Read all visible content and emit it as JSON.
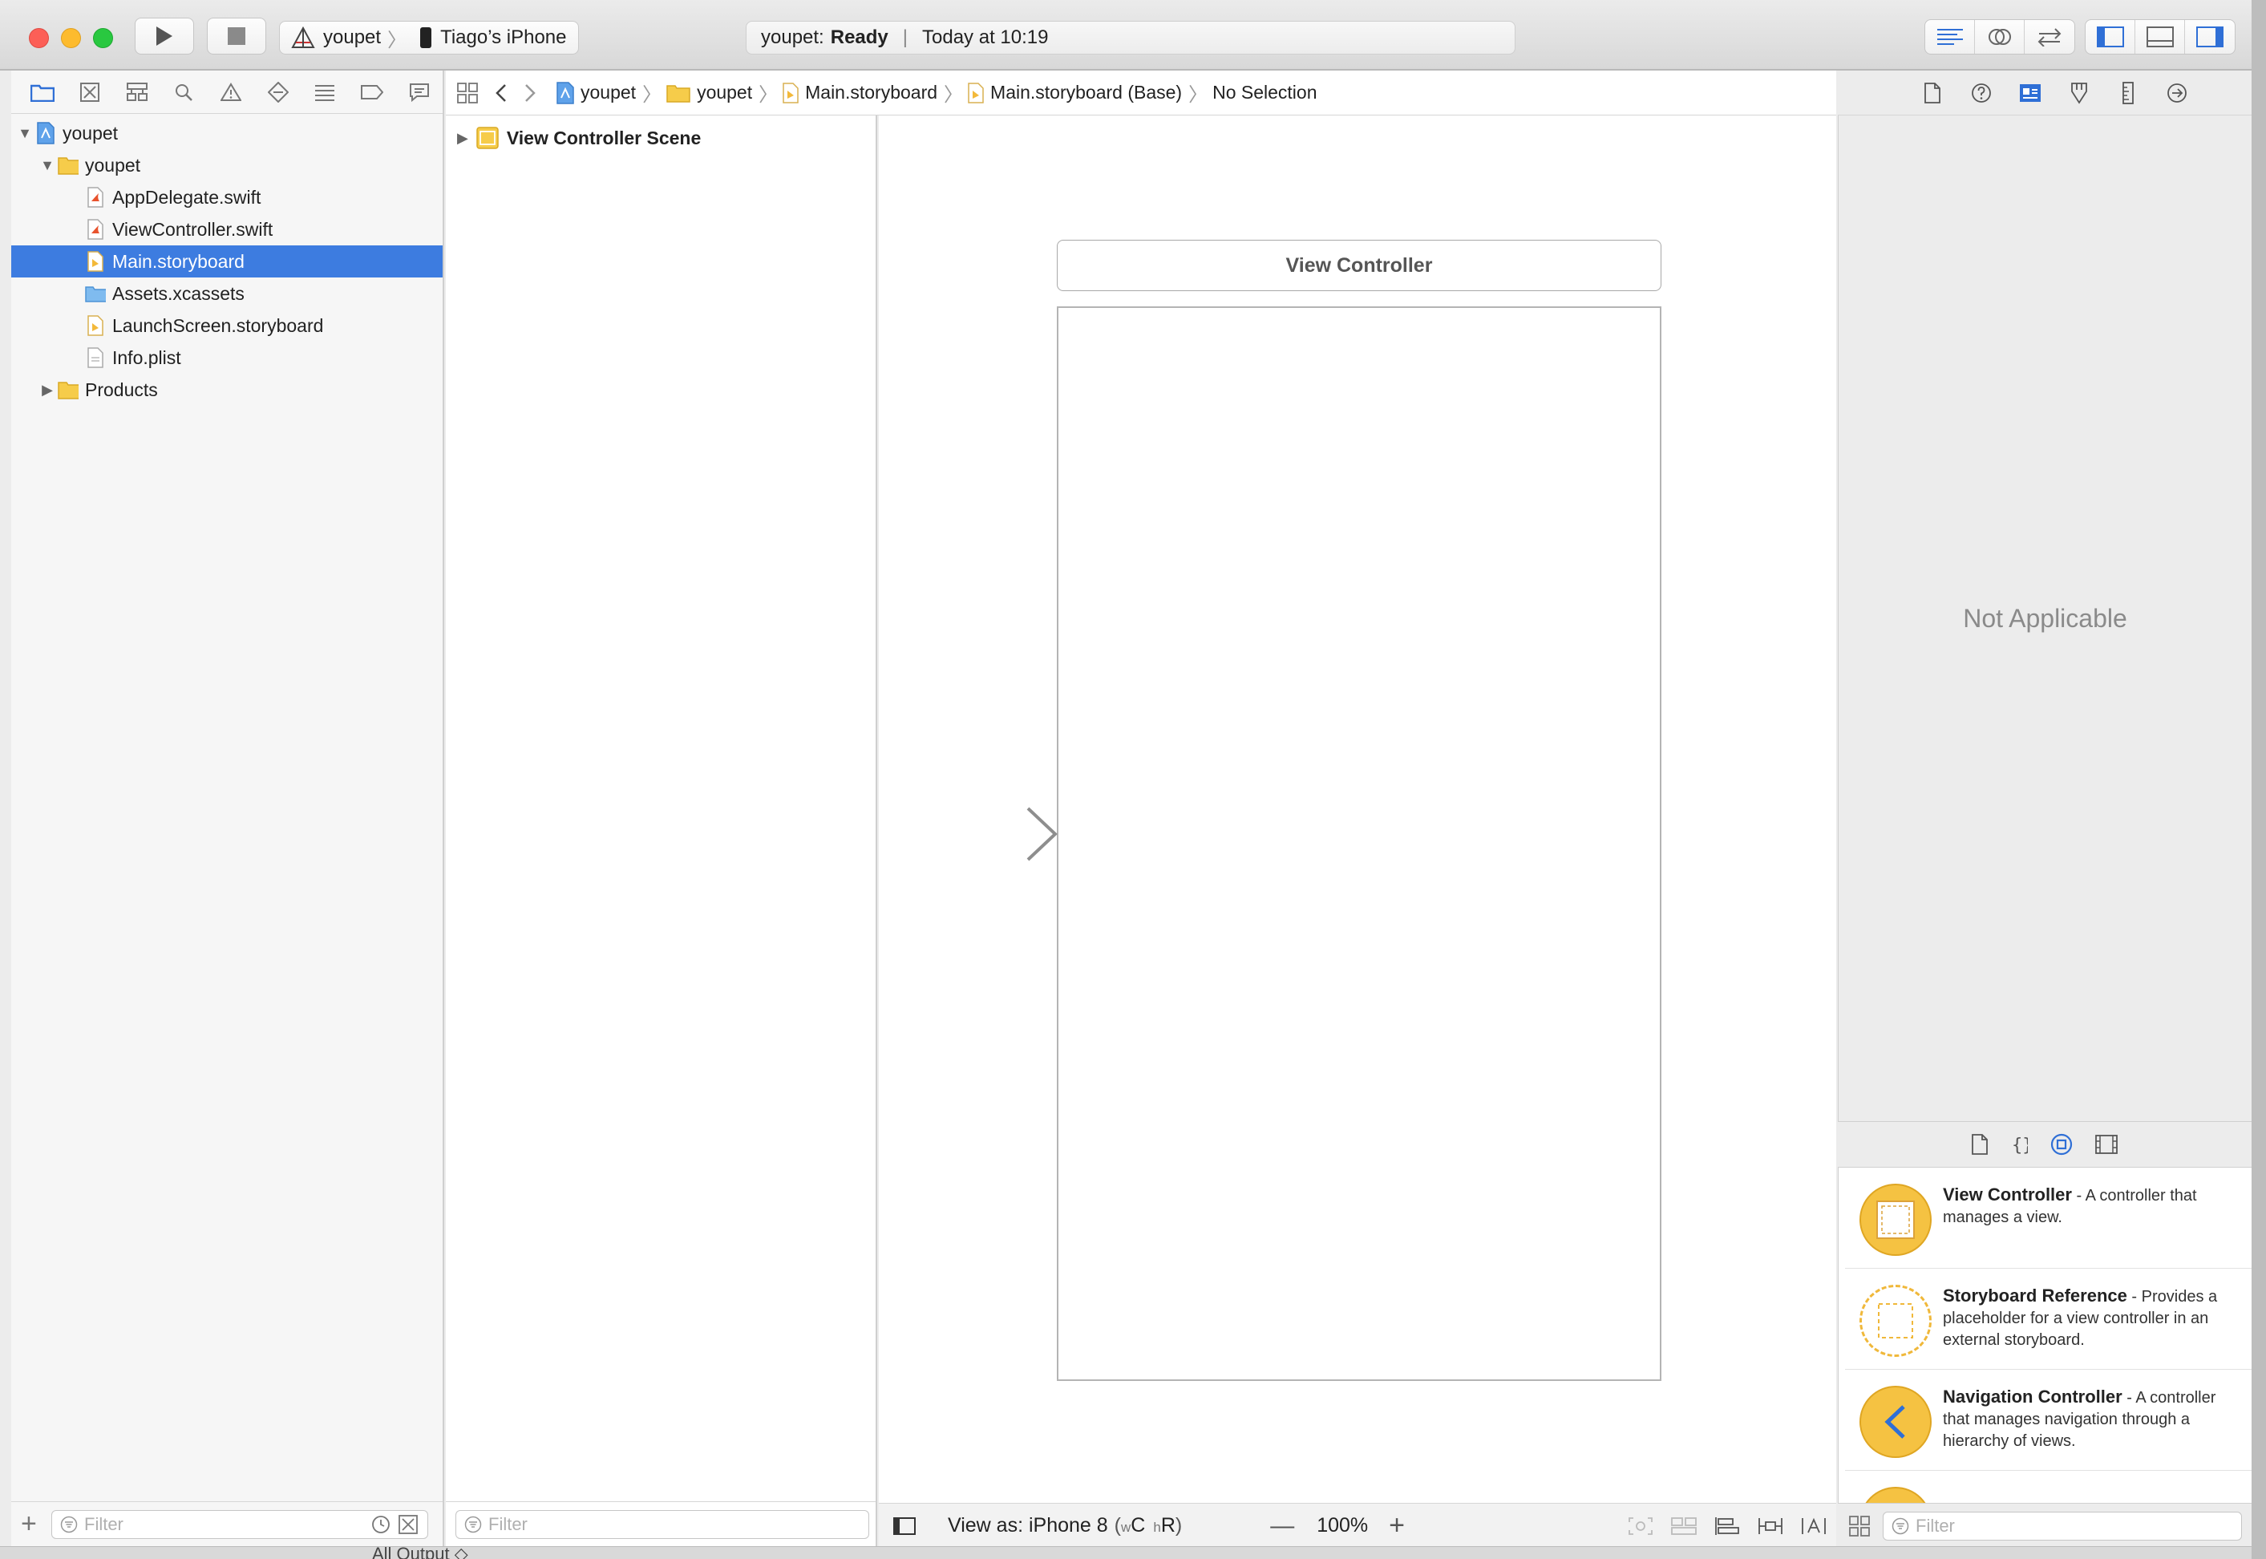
{
  "titlebar": {
    "scheme_project": "youpet",
    "scheme_device": "Tiago’s iPhone",
    "status_project": "youpet:",
    "status_state": "Ready",
    "status_time": "Today at 10:19"
  },
  "navigator": {
    "tree": [
      {
        "label": "youpet",
        "level": 0,
        "expanded": true,
        "kind": "project"
      },
      {
        "label": "youpet",
        "level": 1,
        "expanded": true,
        "kind": "folder"
      },
      {
        "label": "AppDelegate.swift",
        "level": 2,
        "kind": "swift"
      },
      {
        "label": "ViewController.swift",
        "level": 2,
        "kind": "swift"
      },
      {
        "label": "Main.storyboard",
        "level": 2,
        "kind": "storyboard",
        "selected": true
      },
      {
        "label": "Assets.xcassets",
        "level": 2,
        "kind": "assets"
      },
      {
        "label": "LaunchScreen.storyboard",
        "level": 2,
        "kind": "storyboard"
      },
      {
        "label": "Info.plist",
        "level": 2,
        "kind": "plist"
      },
      {
        "label": "Products",
        "level": 1,
        "expanded": false,
        "kind": "folder"
      }
    ],
    "filter_placeholder": "Filter"
  },
  "jumpbar": {
    "crumbs": [
      "youpet",
      "youpet",
      "Main.storyboard",
      "Main.storyboard (Base)",
      "No Selection"
    ]
  },
  "outline": {
    "scene_label": "View Controller Scene",
    "filter_placeholder": "Filter"
  },
  "canvas": {
    "vc_title": "View Controller",
    "view_as": "View as: iPhone 8",
    "size_class_w": "w",
    "size_class_w_val": "C",
    "size_class_h": "h",
    "size_class_h_val": "R",
    "zoom": "100%"
  },
  "inspector": {
    "placeholder": "Not Applicable"
  },
  "library": {
    "items": [
      {
        "title": "View Controller",
        "desc": " - A controller that manages a view."
      },
      {
        "title": "Storyboard Reference",
        "desc": " - Provides a placeholder for a view controller in an external storyboard."
      },
      {
        "title": "Navigation Controller",
        "desc": " - A controller that manages navigation through a hierarchy of views."
      }
    ],
    "filter_placeholder": "Filter"
  },
  "debug_bar": {
    "output_label": "All Output ◇"
  },
  "colors": {
    "selection": "#3d7ce0",
    "accent": "#2f6fd6",
    "library_yellow": "#f5c242"
  }
}
